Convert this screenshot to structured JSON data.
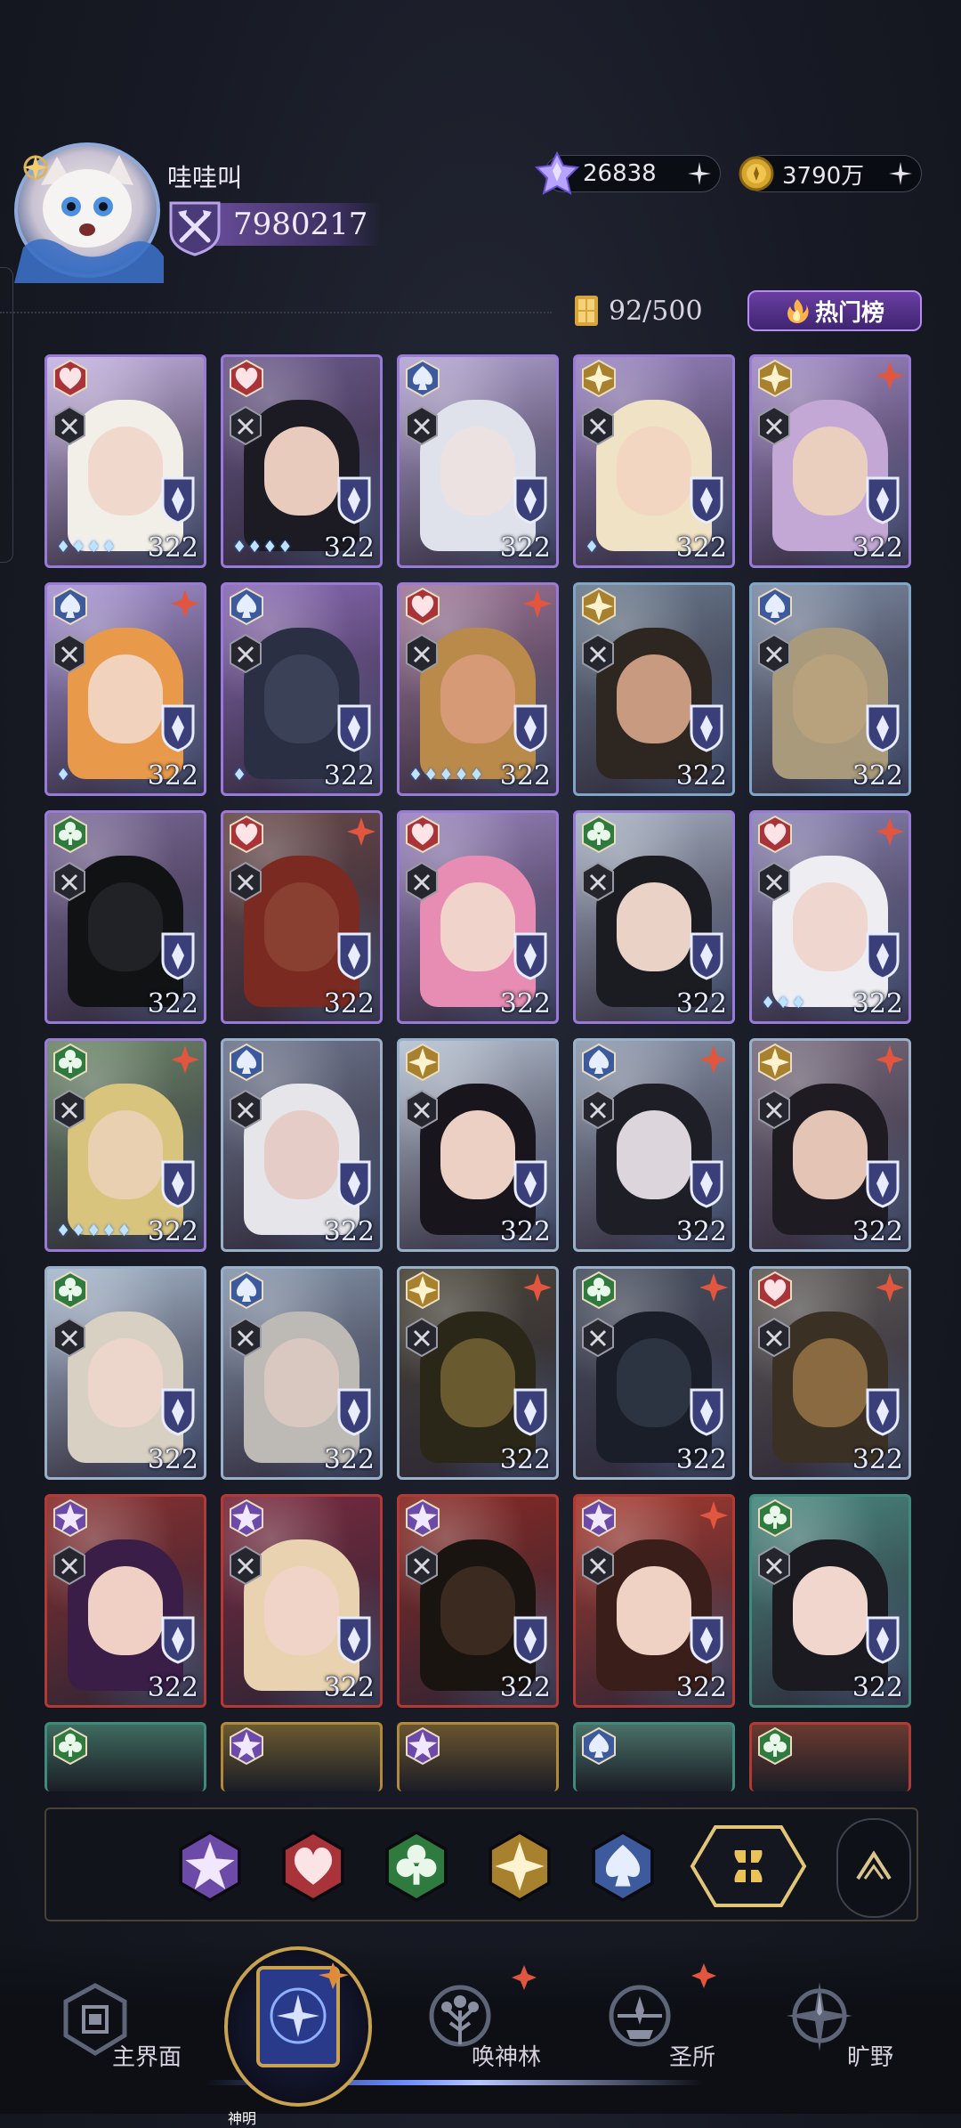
{
  "profile": {
    "username": "哇哇叫",
    "power": "7980217"
  },
  "currencies": {
    "diamond": "26838",
    "gold": "3790万"
  },
  "inventory": {
    "capacity": "92/500"
  },
  "hot_button": {
    "label": "热门榜"
  },
  "cards": [
    {
      "suit": "heart",
      "level": "322",
      "stars": "♦♦♦♦",
      "frame": "#9a7ad8",
      "art": "#c9b6e6",
      "hair": "#f2efe9",
      "face": "#f0d8cc",
      "corner": false
    },
    {
      "suit": "heart",
      "level": "322",
      "stars": "♦♦♦♦",
      "frame": "#9a7ad8",
      "art": "#6c5a8c",
      "hair": "#1c1a22",
      "face": "#e8cbbd",
      "corner": false
    },
    {
      "suit": "spade",
      "level": "322",
      "stars": "",
      "frame": "#9a7ad8",
      "art": "#b6a7d6",
      "hair": "#dfe2ea",
      "face": "#ece2e2",
      "corner": false
    },
    {
      "suit": "diamond",
      "level": "322",
      "stars": "♦",
      "frame": "#9a7ad8",
      "art": "#9c87c4",
      "hair": "#f0e2c4",
      "face": "#f2d6c2",
      "corner": false
    },
    {
      "suit": "diamond",
      "level": "322",
      "stars": "",
      "frame": "#9a7ad8",
      "art": "#a48cc9",
      "hair": "#c3a8d6",
      "face": "#eacfbf",
      "corner": true
    },
    {
      "suit": "spade",
      "level": "322",
      "stars": "♦",
      "frame": "#9a7ad8",
      "art": "#a995d6",
      "hair": "#e89a4a",
      "face": "#f1d2bc",
      "corner": true
    },
    {
      "suit": "spade",
      "level": "322",
      "stars": "♦",
      "frame": "#9a7ad8",
      "art": "#8b6bb5",
      "hair": "#2a2f44",
      "face": "#3b4258",
      "corner": false
    },
    {
      "suit": "heart",
      "level": "322",
      "stars": "♦♦♦♦♦",
      "frame": "#9a7ad8",
      "art": "#a27a9c",
      "hair": "#b98a4a",
      "face": "#d69a76",
      "corner": true
    },
    {
      "suit": "diamond",
      "level": "322",
      "stars": "",
      "frame": "#7fa6c8",
      "art": "#6c7d90",
      "hair": "#2e2620",
      "face": "#c89a80",
      "corner": false
    },
    {
      "suit": "spade",
      "level": "322",
      "stars": "",
      "frame": "#7fa6c8",
      "art": "#7f8ea6",
      "hair": "#a89a7a",
      "face": "#b8a27e",
      "corner": false
    },
    {
      "suit": "club",
      "level": "322",
      "stars": "",
      "frame": "#9a7ad8",
      "art": "#7d6b9a",
      "hair": "#111214",
      "face": "#202226",
      "corner": false
    },
    {
      "suit": "heart",
      "level": "322",
      "stars": "",
      "frame": "#9a7ad8",
      "art": "#6a4a4a",
      "hair": "#7a2a20",
      "face": "#8a4030",
      "corner": true
    },
    {
      "suit": "heart",
      "level": "322",
      "stars": "",
      "frame": "#9a7ad8",
      "art": "#9c86c0",
      "hair": "#e78cb2",
      "face": "#f0d4cc",
      "corner": false
    },
    {
      "suit": "club",
      "level": "322",
      "stars": "",
      "frame": "#9a7ad8",
      "art": "#a8b3c6",
      "hair": "#1b1b22",
      "face": "#ead2c6",
      "corner": false
    },
    {
      "suit": "heart",
      "level": "322",
      "stars": "♦♦♦",
      "frame": "#9a7ad8",
      "art": "#8d86b6",
      "hair": "#eeeef2",
      "face": "#efd6cf",
      "corner": true
    },
    {
      "suit": "club",
      "level": "322",
      "stars": "♦♦♦♦♦",
      "frame": "#9a7ad8",
      "art": "#6e8a6a",
      "hair": "#d9c47e",
      "face": "#e8d0b0",
      "corner": true
    },
    {
      "suit": "spade",
      "level": "322",
      "stars": "",
      "frame": "#9ab0c8",
      "art": "#707890",
      "hair": "#e6e6ea",
      "face": "#e6ccc6",
      "corner": false
    },
    {
      "suit": "diamond",
      "level": "322",
      "stars": "",
      "frame": "#9ab0c8",
      "art": "#b7c3d4",
      "hair": "#18161c",
      "face": "#ecd0c4",
      "corner": false
    },
    {
      "suit": "spade",
      "level": "322",
      "stars": "",
      "frame": "#9ab0c8",
      "art": "#8f9bb0",
      "hair": "#1e1e26",
      "face": "#dcd6dc",
      "corner": true
    },
    {
      "suit": "diamond",
      "level": "322",
      "stars": "",
      "frame": "#9ab0c8",
      "art": "#7a6e80",
      "hair": "#1e1c22",
      "face": "#e4c4b4",
      "corner": true
    },
    {
      "suit": "club",
      "level": "322",
      "stars": "",
      "frame": "#9ab0c8",
      "art": "#a9bbd0",
      "hair": "#d8d0c2",
      "face": "#ecd6cc",
      "corner": false
    },
    {
      "suit": "spade",
      "level": "322",
      "stars": "",
      "frame": "#9ab0c8",
      "art": "#8898ae",
      "hair": "#bdb9b4",
      "face": "#d8c8c0",
      "corner": false
    },
    {
      "suit": "diamond",
      "level": "322",
      "stars": "",
      "frame": "#9ab0c8",
      "art": "#4a4638",
      "hair": "#2a2618",
      "face": "#6a5a30",
      "corner": true
    },
    {
      "suit": "club",
      "level": "322",
      "stars": "",
      "frame": "#9ab0c8",
      "art": "#4a5262",
      "hair": "#1a1e28",
      "face": "#2c3442",
      "corner": true
    },
    {
      "suit": "heart",
      "level": "322",
      "stars": "",
      "frame": "#9ab0c8",
      "art": "#5e5a56",
      "hair": "#3a3024",
      "face": "#8a6a40",
      "corner": true
    },
    {
      "suit": "star",
      "level": "322",
      "stars": "",
      "frame": "#b33a34",
      "art": "#8a3030",
      "hair": "#3a1e48",
      "face": "#f0d0c4",
      "corner": false
    },
    {
      "suit": "star",
      "level": "322",
      "stars": "",
      "frame": "#b33a34",
      "art": "#7a2a3e",
      "hair": "#e8d2b0",
      "face": "#f0d4c8",
      "corner": false
    },
    {
      "suit": "star",
      "level": "322",
      "stars": "",
      "frame": "#b33a34",
      "art": "#8a2a24",
      "hair": "#1a1410",
      "face": "#3a2a20",
      "corner": false
    },
    {
      "suit": "star",
      "level": "322",
      "stars": "",
      "frame": "#b33a34",
      "art": "#a83a2e",
      "hair": "#3a1e1a",
      "face": "#f0d2c4",
      "corner": true
    },
    {
      "suit": "club",
      "level": "322",
      "stars": "",
      "frame": "#3e8a7c",
      "art": "#4a8a80",
      "hair": "#1a1a20",
      "face": "#f0d6cc",
      "corner": false
    }
  ],
  "cards_partial_row": [
    {
      "suit": "club",
      "frame": "#3e8a7c",
      "art": "#3e6a5e"
    },
    {
      "suit": "star",
      "frame": "#b08a3a",
      "art": "#6a5a30"
    },
    {
      "suit": "star",
      "frame": "#b08a3a",
      "art": "#6a5430"
    },
    {
      "suit": "spade",
      "frame": "#3e8a7c",
      "art": "#4a7068"
    },
    {
      "suit": "club",
      "frame": "#b33a34",
      "art": "#6a3a30"
    }
  ],
  "filters": [
    {
      "name": "star",
      "color": "#6c4aa8"
    },
    {
      "name": "heart",
      "color": "#a8343a"
    },
    {
      "name": "club",
      "color": "#2f7a3e"
    },
    {
      "name": "diamond",
      "color": "#a8812e"
    },
    {
      "name": "spade",
      "color": "#3c5a9c"
    }
  ],
  "nav": {
    "main": "主界面",
    "shenming": "神明",
    "summon": "唤神林",
    "sanctuary": "圣所",
    "wild": "旷野"
  },
  "colors": {
    "accent_purple": "#8b5fd6",
    "gold": "#c9a24f",
    "notify_red": "#e2553e"
  }
}
